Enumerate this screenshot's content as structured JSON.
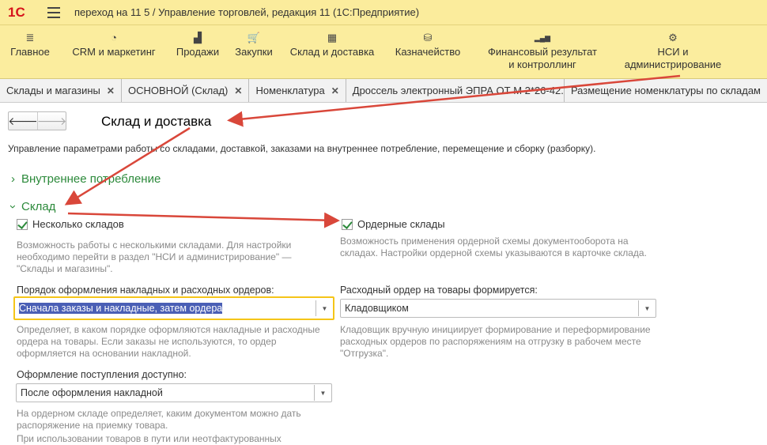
{
  "app": {
    "logo": "1С",
    "title": "переход на 11 5 / Управление торговлей, редакция 11  (1С:Предприятие)"
  },
  "menu": [
    {
      "label": "Главное",
      "icon": "≣"
    },
    {
      "label": "CRM и маркетинг",
      "icon": "◔"
    },
    {
      "label": "Продажи",
      "icon": "▟"
    },
    {
      "label": "Закупки",
      "icon": "🛒"
    },
    {
      "label": "Склад и доставка",
      "icon": "▦"
    },
    {
      "label": "Казначейство",
      "icon": "⛁"
    },
    {
      "label": "Финансовый результат и контроллинг",
      "icon": "▂▄▆"
    },
    {
      "label": "НСИ и администрирование",
      "icon": "⚙"
    }
  ],
  "tabs": [
    "Склады и магазины",
    "ОСНОВНОЙ (Склад)",
    "Номенклатура",
    "Дроссель электронный ЭПРА ОТ М 2*26-42...",
    "Размещение номенклатуры по складам"
  ],
  "page": {
    "title": "Склад и доставка",
    "description": "Управление параметрами работы со складами, доставкой, заказами на внутреннее потребление, перемещение и сборку (разборку).",
    "group1": "Внутреннее потребление",
    "group2": "Склад",
    "multi_wh": {
      "label": "Несколько складов",
      "checked": true,
      "hint": "Возможность работы с несколькими складами. Для настройки необходимо перейти в раздел \"НСИ и администрирование\" — \"Склады и магазины\"."
    },
    "order_wh": {
      "label": "Ордерные склады",
      "checked": true,
      "hint": "Возможность применения ордерной схемы документооборота на складах. Настройки ордерной схемы указываются в карточке склада."
    },
    "order_proc": {
      "label": "Порядок оформления накладных и расходных ордеров:",
      "value": "Сначала заказы и накладные, затем ордера",
      "hint": "Определяет, в каком порядке оформляются накладные и расходные ордера на товары. Если заказы не используются, то ордер оформляется на основании накладной."
    },
    "expense_order": {
      "label": "Расходный ордер на товары формируется:",
      "value": "Кладовщиком",
      "hint": "Кладовщик вручную инициирует формирование и переформирование расходных ордеров по распоряжениям на отгрузку в рабочем месте \"Отгрузка\"."
    },
    "receipt": {
      "label": "Оформление поступления доступно:",
      "value": "После оформления накладной",
      "hint": "На ордерном складе определяет, каким документом можно дать распоряжение на приемку товара.",
      "hint2": "При использовании товаров в пути или неотфактурованных"
    }
  }
}
